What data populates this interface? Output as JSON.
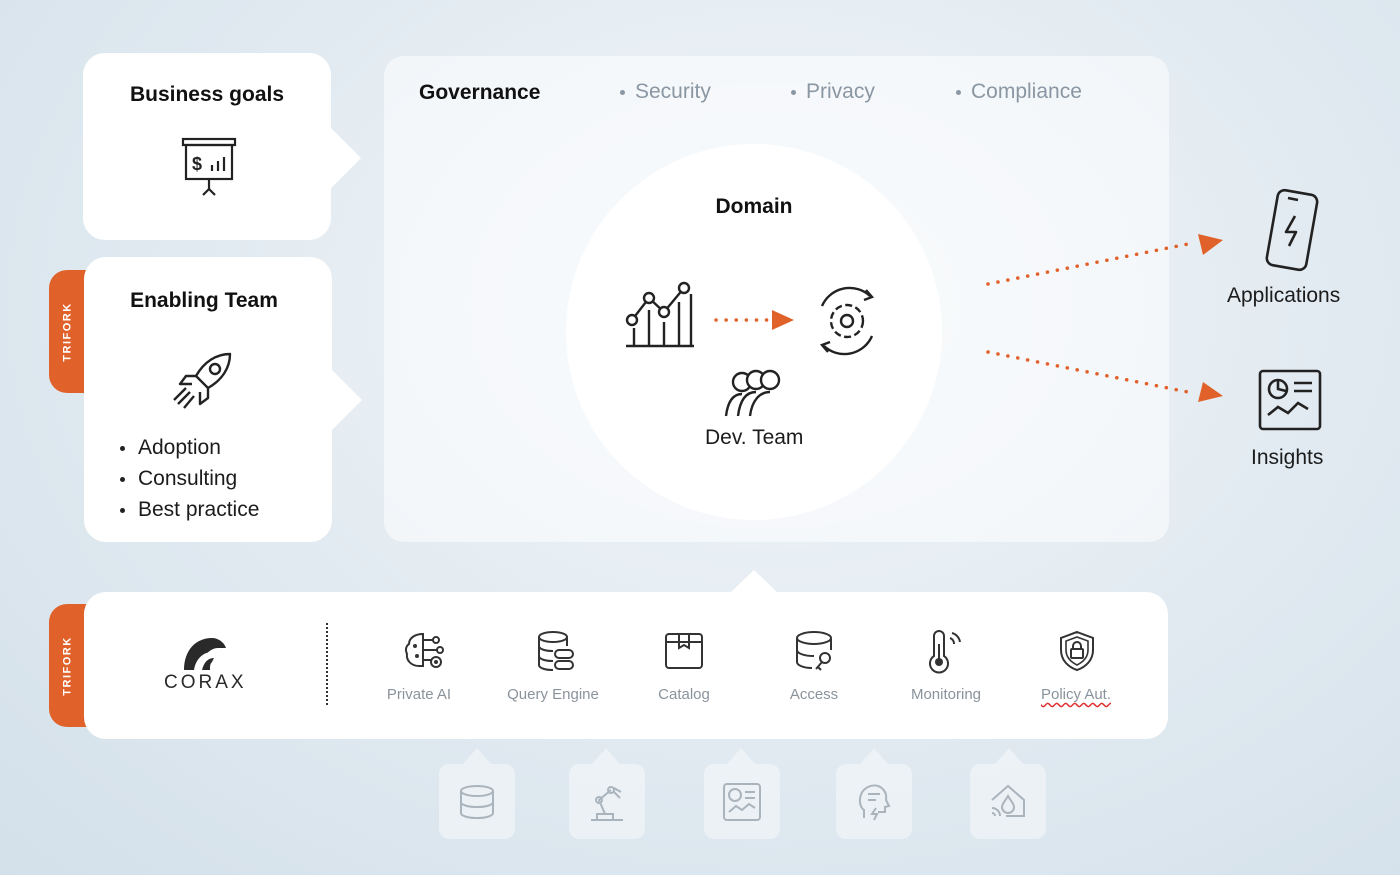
{
  "brand_tab_label": "TRIFORK",
  "business_goals": {
    "title": "Business goals",
    "icon": "presentation-dollar-chart-icon"
  },
  "enabling_team": {
    "title": "Enabling Team",
    "icon": "rocket-icon",
    "bullets": [
      "Adoption",
      "Consulting",
      "Best practice"
    ]
  },
  "governance": {
    "title": "Governance",
    "items": [
      "Security",
      "Privacy",
      "Compliance"
    ]
  },
  "domain": {
    "title": "Domain",
    "icons": [
      "analytics-chart-icon",
      "gear-cycle-icon",
      "people-group-icon"
    ],
    "team_label": "Dev. Team"
  },
  "outputs": [
    {
      "label": "Applications",
      "icon": "smartphone-lightning-icon"
    },
    {
      "label": "Insights",
      "icon": "report-chart-icon"
    }
  ],
  "platform": {
    "logo_text": "CORAX",
    "tools": [
      {
        "label": "Private AI",
        "icon": "ai-brain-icon"
      },
      {
        "label": "Query Engine",
        "icon": "database-query-icon"
      },
      {
        "label": "Catalog",
        "icon": "catalog-box-icon"
      },
      {
        "label": "Access",
        "icon": "database-key-icon"
      },
      {
        "label": "Monitoring",
        "icon": "thermometer-signal-icon"
      },
      {
        "label": "Policy Aut.",
        "icon": "shield-lock-icon"
      }
    ]
  },
  "sources": [
    {
      "icon": "database-icon"
    },
    {
      "icon": "robot-arm-icon"
    },
    {
      "icon": "report-icon"
    },
    {
      "icon": "head-lightning-icon"
    },
    {
      "icon": "smart-home-icon"
    }
  ],
  "colors": {
    "accent": "#e0622a",
    "muted_text": "#8a97a3",
    "card": "#ffffff"
  }
}
